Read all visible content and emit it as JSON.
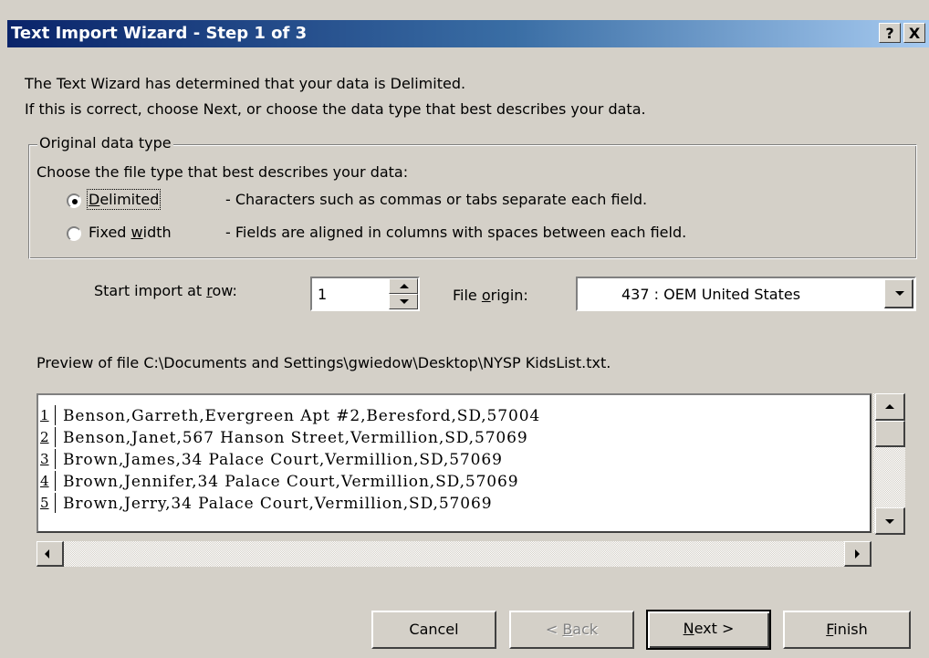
{
  "window": {
    "title": "Text Import Wizard - Step 1 of 3",
    "help_button": "?",
    "close_button": "X"
  },
  "intro": {
    "line1": "The Text Wizard has determined that your data is Delimited.",
    "line2": "If this is correct, choose Next, or choose the data type that best describes your data."
  },
  "original_data_type": {
    "legend": "Original data type",
    "prompt": "Choose the file type that best describes your data:",
    "options": [
      {
        "label": "Delimited",
        "hotkey_prefix": "",
        "hotkey": "D",
        "hotkey_suffix": "elimited",
        "description": "- Characters such as commas or tabs separate each field.",
        "selected": true
      },
      {
        "label": "Fixed width",
        "hotkey_prefix": "Fixed ",
        "hotkey": "w",
        "hotkey_suffix": "idth",
        "description": "- Fields are aligned in columns with spaces between each field.",
        "selected": false
      }
    ]
  },
  "start_import": {
    "label_prefix": "Start import at ",
    "label_hotkey": "r",
    "label_suffix": "ow:",
    "value": "1"
  },
  "file_origin": {
    "label_prefix": "File ",
    "label_hotkey": "o",
    "label_suffix": "rigin:",
    "value": "437 : OEM United States"
  },
  "preview": {
    "label": "Preview of file C:\\Documents and Settings\\gwiedow\\Desktop\\NYSP KidsList.txt.",
    "rows": [
      {
        "num": "1",
        "text": "Benson,Garreth,Evergreen Apt #2,Beresford,SD,57004"
      },
      {
        "num": "2",
        "text": "Benson,Janet,567 Hanson Street,Vermillion,SD,57069"
      },
      {
        "num": "3",
        "text": "Brown,James,34 Palace Court,Vermillion,SD,57069"
      },
      {
        "num": "4",
        "text": "Brown,Jennifer,34 Palace Court,Vermillion,SD,57069"
      },
      {
        "num": "5",
        "text": "Brown,Jerry,34 Palace Court,Vermillion,SD,57069"
      }
    ]
  },
  "buttons": {
    "cancel": "Cancel",
    "back_prefix": "< ",
    "back_hotkey": "B",
    "back_suffix": "ack",
    "next_hotkey": "N",
    "next_suffix": "ext >",
    "finish_hotkey": "F",
    "finish_suffix": "inish"
  },
  "colors": {
    "dialog_bg": "#d4d0c8",
    "title_start": "#0a246a",
    "title_end": "#a6caf0"
  }
}
